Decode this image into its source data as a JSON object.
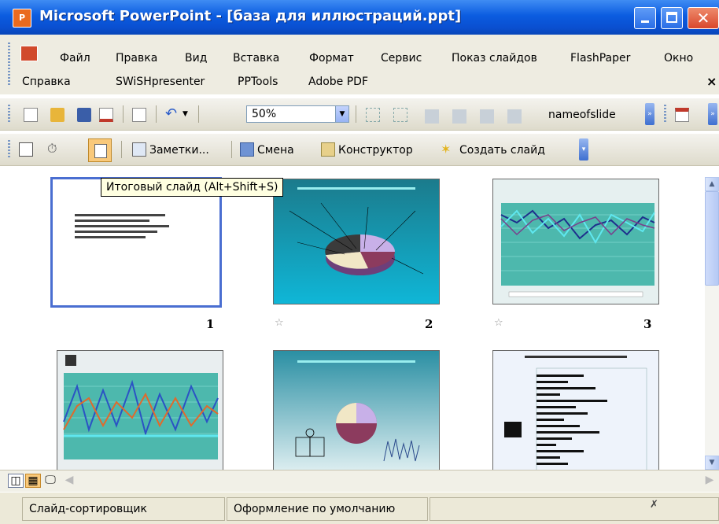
{
  "window": {
    "title": "Microsoft PowerPoint - [база для иллюстраций.ppt]",
    "app_icon": "powerpoint-icon"
  },
  "menu": {
    "row1": [
      "Файл",
      "Правка",
      "Вид",
      "Вставка",
      "Формат",
      "Сервис",
      "Показ слайдов",
      "FlashPaper",
      "Окно"
    ],
    "row2": [
      "Справка",
      "SWiSHpresenter",
      "PPTools",
      "Adobe PDF"
    ],
    "close_glyph": "×"
  },
  "standard_toolbar": {
    "zoom": "50%",
    "slide_name_label": "nameofslide"
  },
  "sorter_toolbar": {
    "notes_label": "Заметки...",
    "transition_label": "Смена",
    "design_label": "Конструктор",
    "new_slide_label": "Создать слайд"
  },
  "tooltip": {
    "text": "Итоговый слайд (Alt+Shift+S)"
  },
  "slides": [
    {
      "number": "1",
      "kind": "summary",
      "selected": true
    },
    {
      "number": "2",
      "kind": "pie-chart",
      "selected": false
    },
    {
      "number": "3",
      "kind": "line-chart",
      "selected": false
    },
    {
      "number": "",
      "kind": "line-chart",
      "selected": false
    },
    {
      "number": "",
      "kind": "pie-chart",
      "selected": false
    },
    {
      "number": "",
      "kind": "bar-chart",
      "selected": false
    }
  ],
  "status_bar": {
    "view": "Слайд-сортировщик",
    "design": "Оформление по умолчанию"
  },
  "colors": {
    "titlebar": "#0a4fd0",
    "selected_slide_border": "#4a6ed1",
    "tooltip_bg": "#ffffe1"
  }
}
